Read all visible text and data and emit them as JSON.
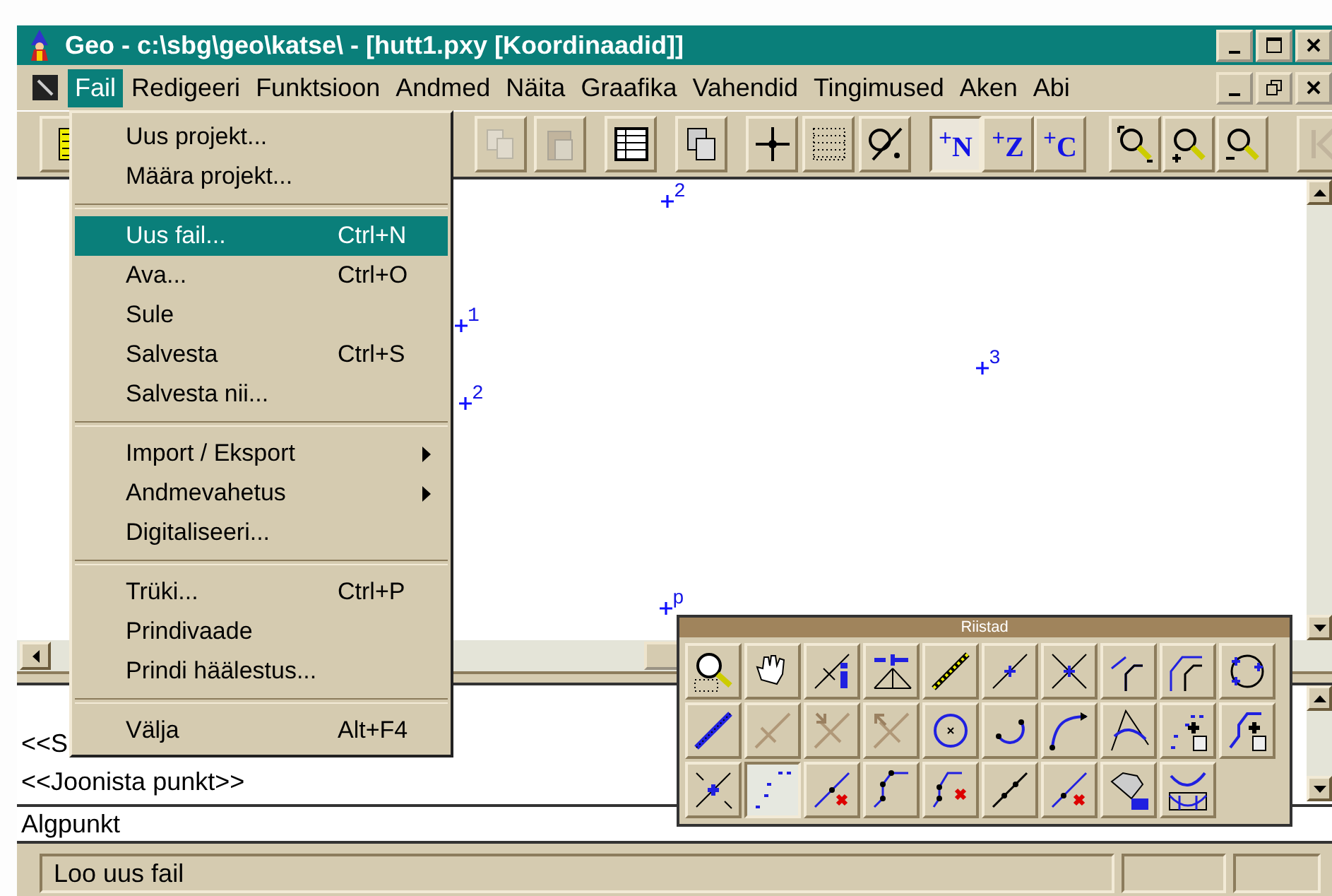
{
  "window": {
    "title": "Geo - c:\\sbg\\geo\\katse\\ - [hutt1.pxy [Koordinaadid]]"
  },
  "menu_bar": [
    {
      "label": "Fail",
      "selected": true
    },
    {
      "label": "Redigeeri",
      "selected": false
    },
    {
      "label": "Funktsioon",
      "selected": false
    },
    {
      "label": "Andmed",
      "selected": false
    },
    {
      "label": "Näita",
      "selected": false
    },
    {
      "label": "Graafika",
      "selected": false
    },
    {
      "label": "Vahendid",
      "selected": false
    },
    {
      "label": "Tingimused",
      "selected": false
    },
    {
      "label": "Aken",
      "selected": false
    },
    {
      "label": "Abi",
      "selected": false
    }
  ],
  "toolbar": [
    {
      "selected": false,
      "disabled": false
    },
    {
      "selected": false,
      "disabled": true
    },
    {
      "selected": false,
      "disabled": true
    },
    {
      "selected": false,
      "disabled": false
    },
    {
      "selected": false,
      "disabled": false
    },
    {
      "selected": false,
      "disabled": false
    },
    {
      "selected": false,
      "disabled": false
    },
    {
      "selected": false,
      "disabled": false
    },
    {
      "label": "$^{+}$N",
      "selected": true,
      "disabled": false
    },
    {
      "label": "$^{+}$Z",
      "selected": false,
      "disabled": false
    },
    {
      "label": "$^{+}$C",
      "selected": false,
      "disabled": false
    },
    {
      "selected": false,
      "disabled": false
    },
    {
      "selected": false,
      "disabled": false
    },
    {
      "selected": false,
      "disabled": false
    },
    {
      "selected": false,
      "disabled": true
    }
  ],
  "file_menu": [
    {
      "kind": "item",
      "label": "Uus projekt...",
      "selected": false,
      "submenu": false
    },
    {
      "kind": "item",
      "label": "Määra projekt...",
      "selected": false,
      "submenu": false
    },
    {
      "kind": "separator"
    },
    {
      "kind": "item",
      "label": "Uus fail...",
      "shortcut": "Ctrl+N",
      "selected": true,
      "submenu": false
    },
    {
      "kind": "item",
      "label": "Ava...",
      "shortcut": "Ctrl+O",
      "selected": false,
      "submenu": false
    },
    {
      "kind": "item",
      "label": "Sule",
      "selected": false,
      "submenu": false
    },
    {
      "kind": "item",
      "label": "Salvesta",
      "shortcut": "Ctrl+S",
      "selected": false,
      "submenu": false
    },
    {
      "kind": "item",
      "label": "Salvesta nii...",
      "selected": false,
      "submenu": false
    },
    {
      "kind": "separator"
    },
    {
      "kind": "item",
      "label": "Import / Eksport",
      "selected": false,
      "submenu": true
    },
    {
      "kind": "item",
      "label": "Andmevahetus",
      "selected": false,
      "submenu": true
    },
    {
      "kind": "item",
      "label": "Digitaliseeri...",
      "selected": false,
      "submenu": false
    },
    {
      "kind": "separator"
    },
    {
      "kind": "item",
      "label": "Trüki...",
      "shortcut": "Ctrl+P",
      "selected": false,
      "submenu": false
    },
    {
      "kind": "item",
      "label": "Prindivaade",
      "selected": false,
      "submenu": false
    },
    {
      "kind": "item",
      "label": "Prindi häälestus...",
      "selected": false,
      "submenu": false
    },
    {
      "kind": "separator"
    },
    {
      "kind": "item",
      "label": "Välja",
      "shortcut": "Alt+F4",
      "selected": false,
      "submenu": false
    }
  ],
  "canvas": {
    "points": [
      {
        "label": "2"
      },
      {
        "label": "1"
      },
      {
        "label": "2"
      },
      {
        "label": "3"
      },
      {
        "label": "p"
      }
    ]
  },
  "command_lines": [
    "<<S",
    "<<Joonista punkt>>"
  ],
  "input": {
    "value": "Algpunkt"
  },
  "status_bar": {
    "text": "Loo uus fail"
  },
  "palette": {
    "title": "Riistad",
    "tools": [
      {
        "selected": false
      },
      {
        "selected": false
      },
      {
        "selected": false
      },
      {
        "selected": false
      },
      {
        "selected": false
      },
      {
        "selected": false
      },
      {
        "selected": false
      },
      {
        "selected": false
      },
      {
        "selected": false
      },
      {
        "selected": false
      },
      {
        "selected": false
      },
      {
        "selected": false
      },
      {
        "selected": false
      },
      {
        "selected": false
      },
      {
        "selected": false
      },
      {
        "selected": false
      },
      {
        "selected": false
      },
      {
        "selected": false
      },
      {
        "selected": false
      },
      {
        "selected": false
      },
      {
        "selected": false
      },
      {
        "selected": true
      },
      {
        "selected": false
      },
      {
        "selected": false
      },
      {
        "selected": false
      },
      {
        "selected": false
      },
      {
        "selected": false
      },
      {
        "selected": false
      },
      {
        "selected": false
      }
    ]
  }
}
